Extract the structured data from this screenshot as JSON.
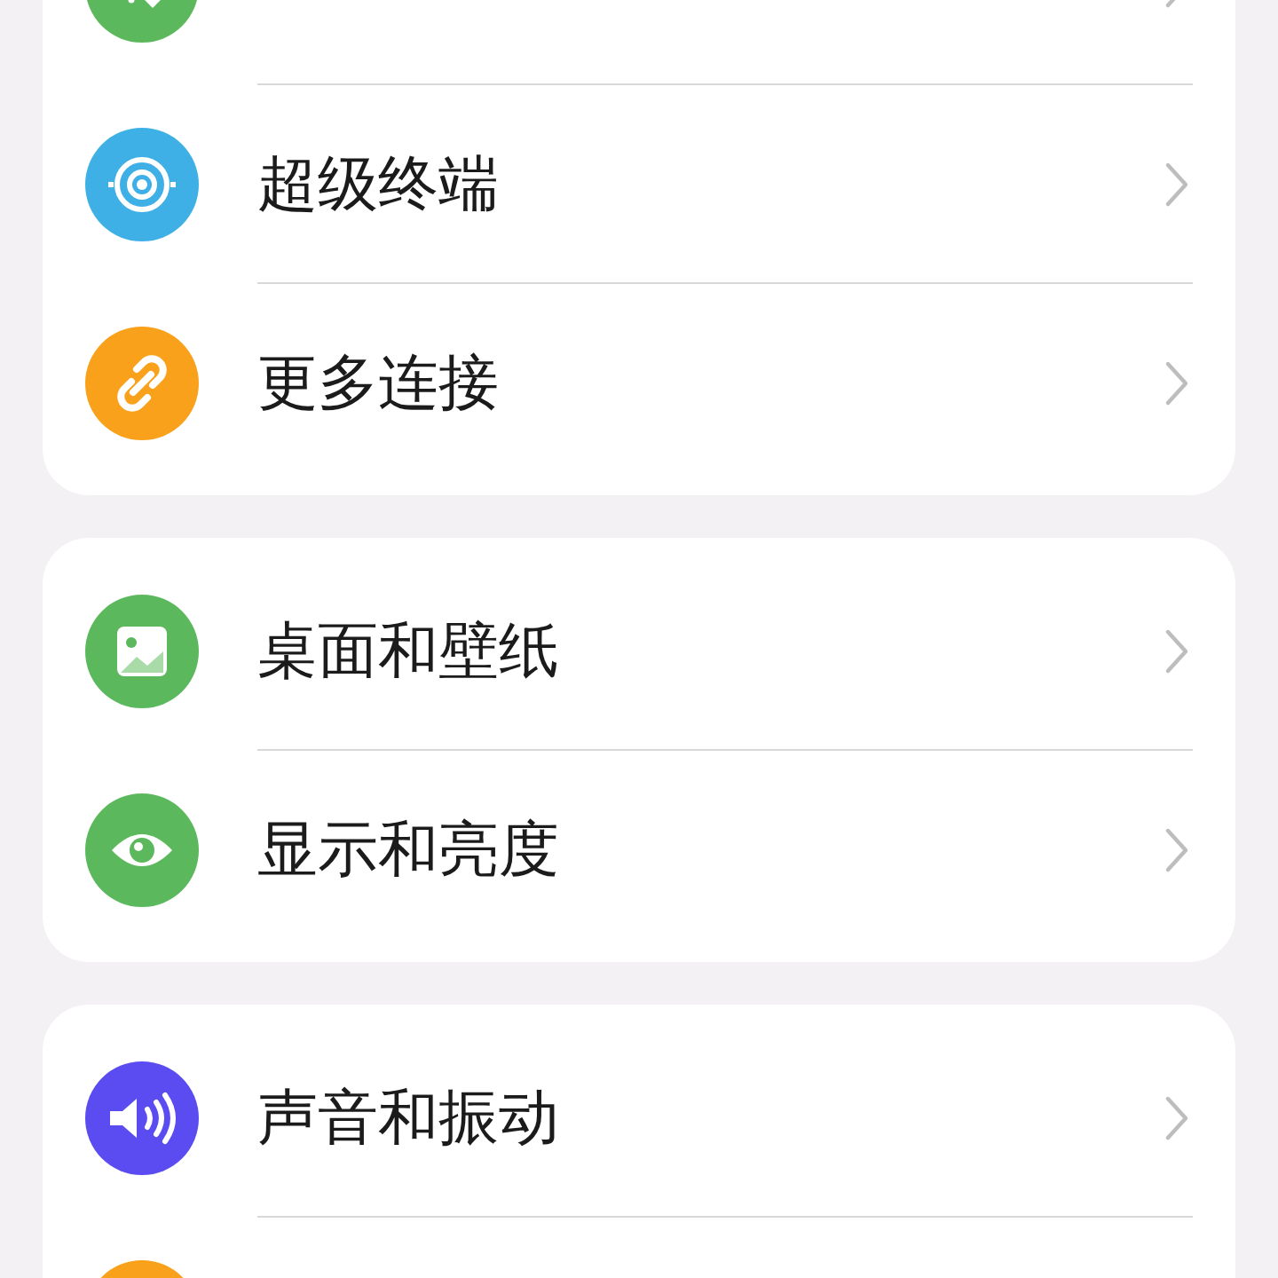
{
  "groups": [
    {
      "items": [
        {
          "kind": "signal",
          "color": "#5cb85c"
        },
        {
          "label": "超级终端",
          "kind": "rings",
          "color": "#3eb0e6"
        },
        {
          "label": "更多连接",
          "kind": "link",
          "color": "#f9a11b"
        }
      ]
    },
    {
      "items": [
        {
          "label": "桌面和壁纸",
          "kind": "image",
          "color": "#5cb85c"
        },
        {
          "label": "显示和亮度",
          "kind": "eye",
          "color": "#5cb85c"
        }
      ]
    },
    {
      "items": [
        {
          "label": "声音和振动",
          "kind": "speaker",
          "color": "#5b4cf2"
        },
        {
          "kind": "blank",
          "color": "#f9a11b"
        }
      ]
    }
  ]
}
